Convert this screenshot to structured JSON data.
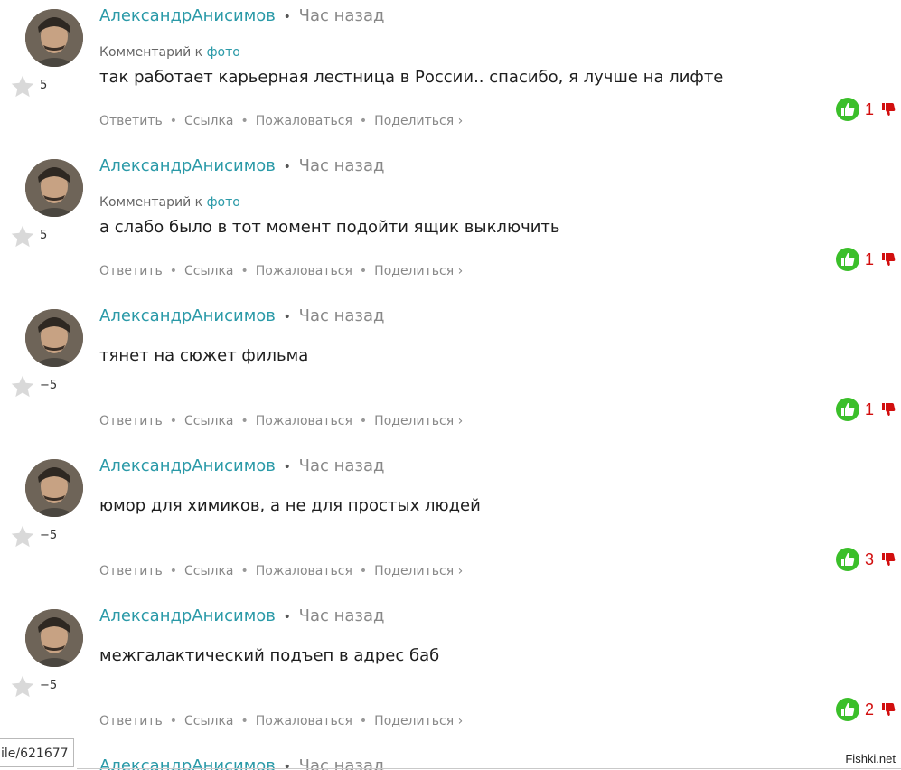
{
  "comments": [
    {
      "author": "АлександрАнисимов",
      "separator": "•",
      "time": "Час назад",
      "context_prefix": "Комментарий к",
      "context_link": "фото",
      "text": "так работает карьерная лестница в России.. спасибо, я лучше на лифте",
      "rating": "5",
      "score": "1"
    },
    {
      "author": "АлександрАнисимов",
      "separator": "•",
      "time": "Час назад",
      "context_prefix": "Комментарий к",
      "context_link": "фото",
      "text": "а слабо было в тот момент подойти ящик выключить",
      "rating": "5",
      "score": "1"
    },
    {
      "author": "АлександрАнисимов",
      "separator": "•",
      "time": "Час назад",
      "context_prefix": "",
      "context_link": "",
      "text": "тянет на сюжет фильма",
      "rating": "−5",
      "score": "1"
    },
    {
      "author": "АлександрАнисимов",
      "separator": "•",
      "time": "Час назад",
      "context_prefix": "",
      "context_link": "",
      "text": "юмор для химиков, а не для простых людей",
      "rating": "−5",
      "score": "3"
    },
    {
      "author": "АлександрАнисимов",
      "separator": "•",
      "time": "Час назад",
      "context_prefix": "",
      "context_link": "",
      "text": "межгалактический подъеп в адрес баб",
      "rating": "−5",
      "score": "2"
    },
    {
      "author": "АлександрАнисимов",
      "separator": "•",
      "time": "Час назад"
    }
  ],
  "actions": {
    "reply": "Ответить",
    "link": "Ссылка",
    "report": "Пожаловаться",
    "share": "Поделиться ›",
    "sep": "•"
  },
  "status_url": "ile/621677",
  "watermark": "Fishki.net",
  "icons": {
    "like": "thumbs-up-icon",
    "dislike": "thumbs-down-icon",
    "rating": "star-icon",
    "avatar": "user-avatar"
  },
  "colors": {
    "author": "#2b9aa8",
    "like": "#3bbf2a",
    "score": "#d20e0e"
  }
}
